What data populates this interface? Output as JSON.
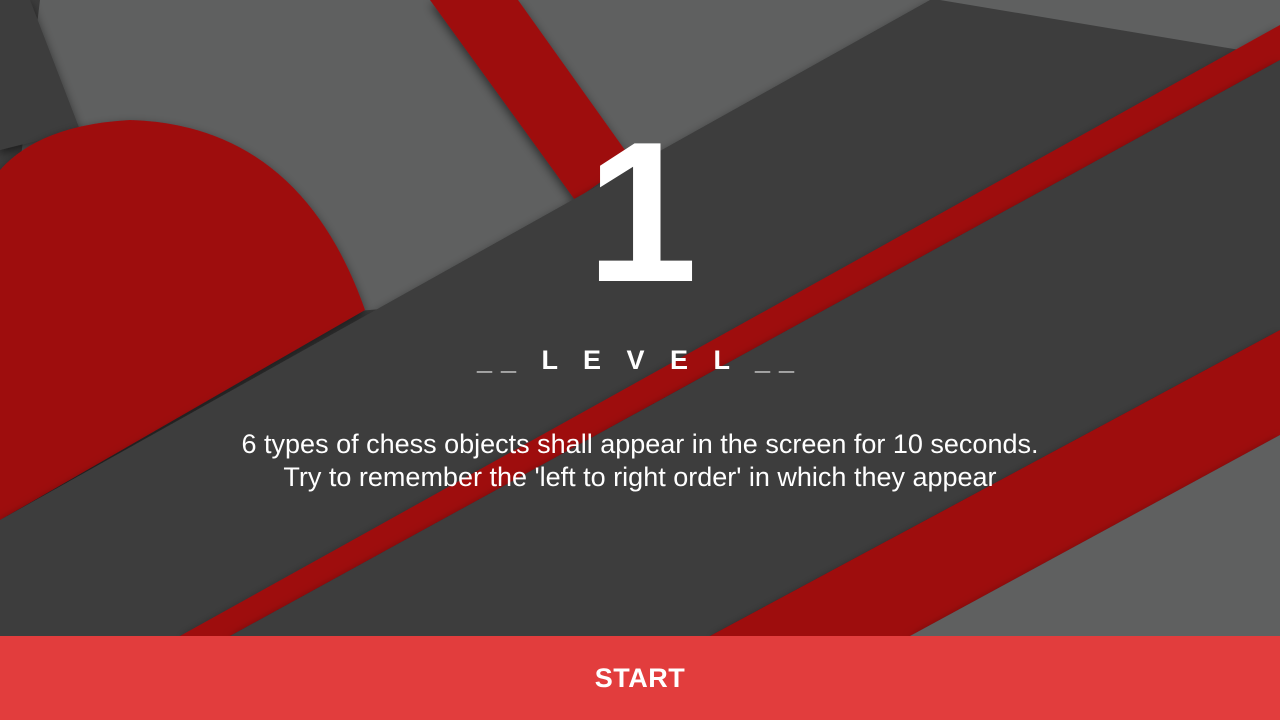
{
  "level": {
    "number": "1",
    "label": "__ L E V E L __"
  },
  "instructions": {
    "line1": "6 types of chess objects shall appear in the screen for 10 seconds.",
    "line2": "Try to remember the 'left to right order' in which they appear"
  },
  "start_button": {
    "label": "START"
  },
  "colors": {
    "dark_gray": "#3c3c3c",
    "light_gray": "#5f6060",
    "red": "#9e0a10",
    "button_red": "#e23d3d",
    "text": "#ffffff"
  }
}
